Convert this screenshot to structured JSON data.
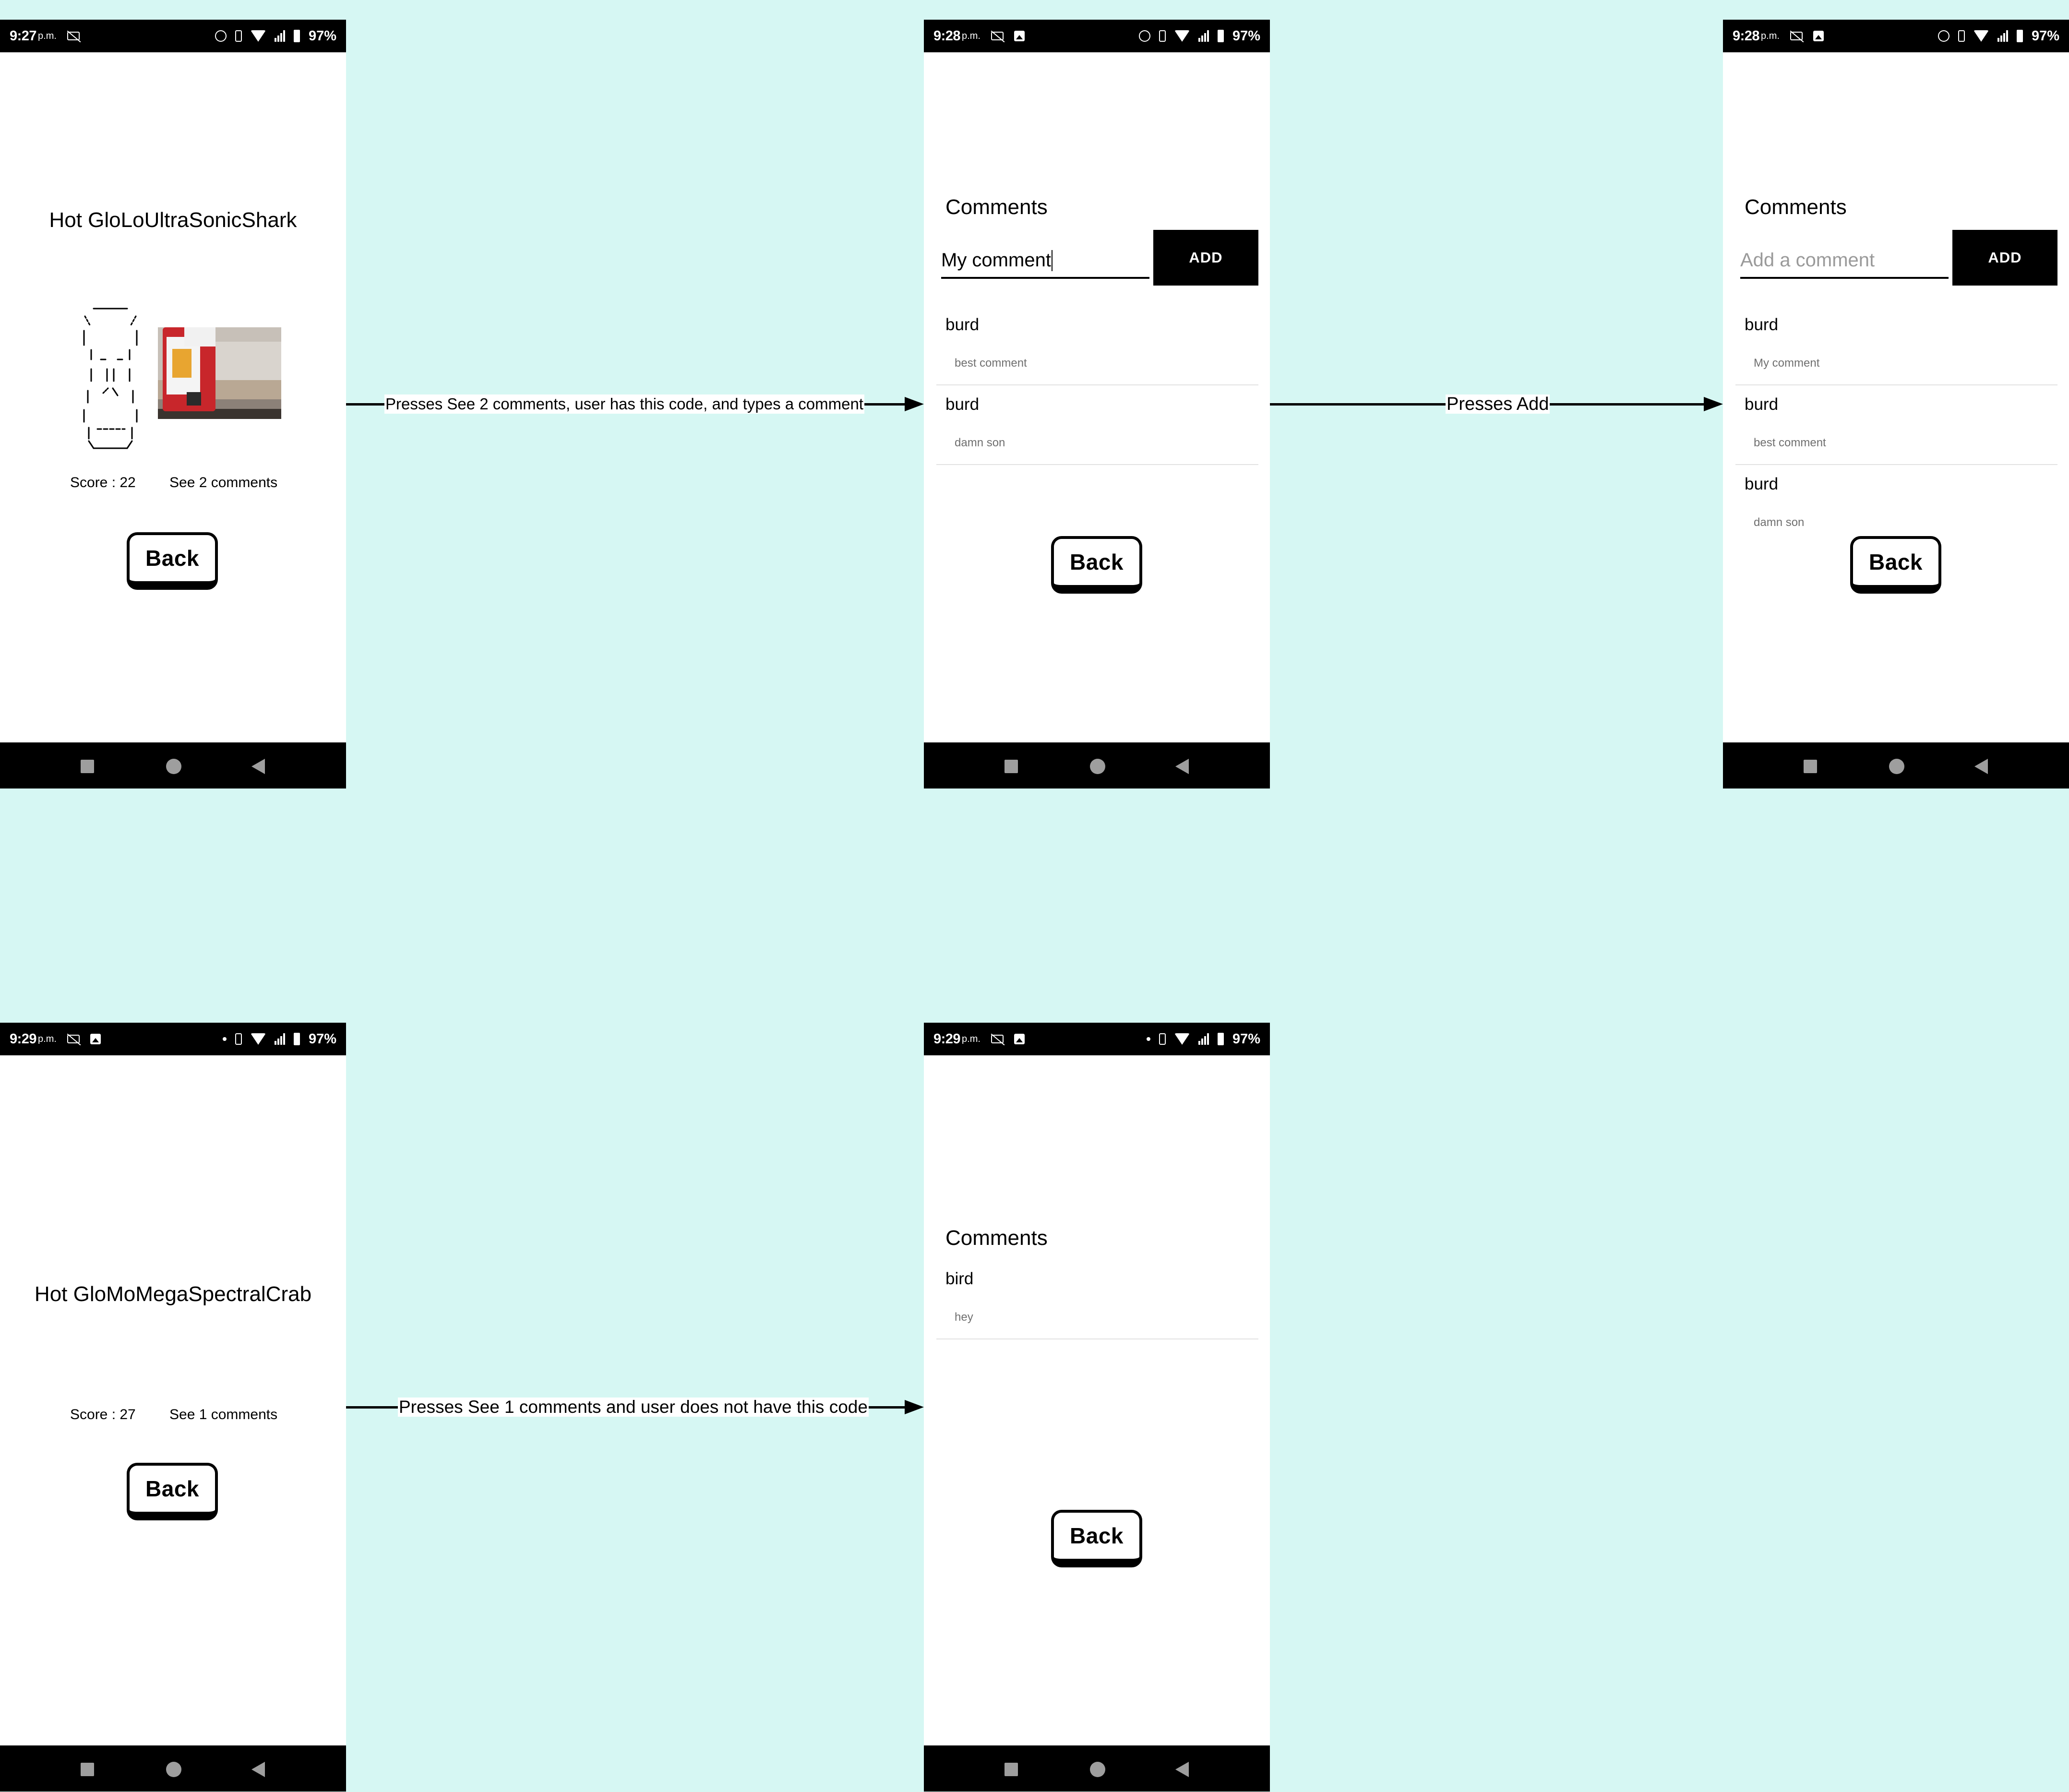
{
  "screen1": {
    "status": {
      "time": "9:27",
      "ampm": "p.m.",
      "battery": "97%"
    },
    "title": "Hot GloLoUltraSonicShark",
    "score": "Score : 22",
    "see_comments": "See 2 comments",
    "back_label": "Back"
  },
  "screen2": {
    "status": {
      "time": "9:28",
      "ampm": "p.m.",
      "battery": "97%"
    },
    "heading": "Comments",
    "input_value": "My comment",
    "add_label": "ADD",
    "comments": [
      {
        "user": "burd",
        "text": "best comment"
      },
      {
        "user": "burd",
        "text": "damn son"
      }
    ],
    "back_label": "Back"
  },
  "screen3": {
    "status": {
      "time": "9:28",
      "ampm": "p.m.",
      "battery": "97%"
    },
    "heading": "Comments",
    "input_placeholder": "Add a comment",
    "add_label": "ADD",
    "comments": [
      {
        "user": "burd",
        "text": "My comment"
      },
      {
        "user": "burd",
        "text": "best comment"
      },
      {
        "user": "burd",
        "text": "damn son"
      }
    ],
    "back_label": "Back"
  },
  "screen4": {
    "status": {
      "time": "9:29",
      "ampm": "p.m.",
      "battery": "97%"
    },
    "title": "Hot GloMoMegaSpectralCrab",
    "score": "Score : 27",
    "see_comments": "See 1 comments",
    "back_label": "Back"
  },
  "screen5": {
    "status": {
      "time": "9:29",
      "ampm": "p.m.",
      "battery": "97%"
    },
    "heading": "Comments",
    "comments": [
      {
        "user": "bird",
        "text": "hey"
      }
    ],
    "back_label": "Back"
  },
  "arrows": {
    "a1": "Presses See 2 comments, user has this code, and types a comment",
    "a2": "Presses Add",
    "a3": "Presses See 1 comments and user does not have this code"
  },
  "colors": {
    "background": "#d6f7f3",
    "bars": "#000000"
  }
}
